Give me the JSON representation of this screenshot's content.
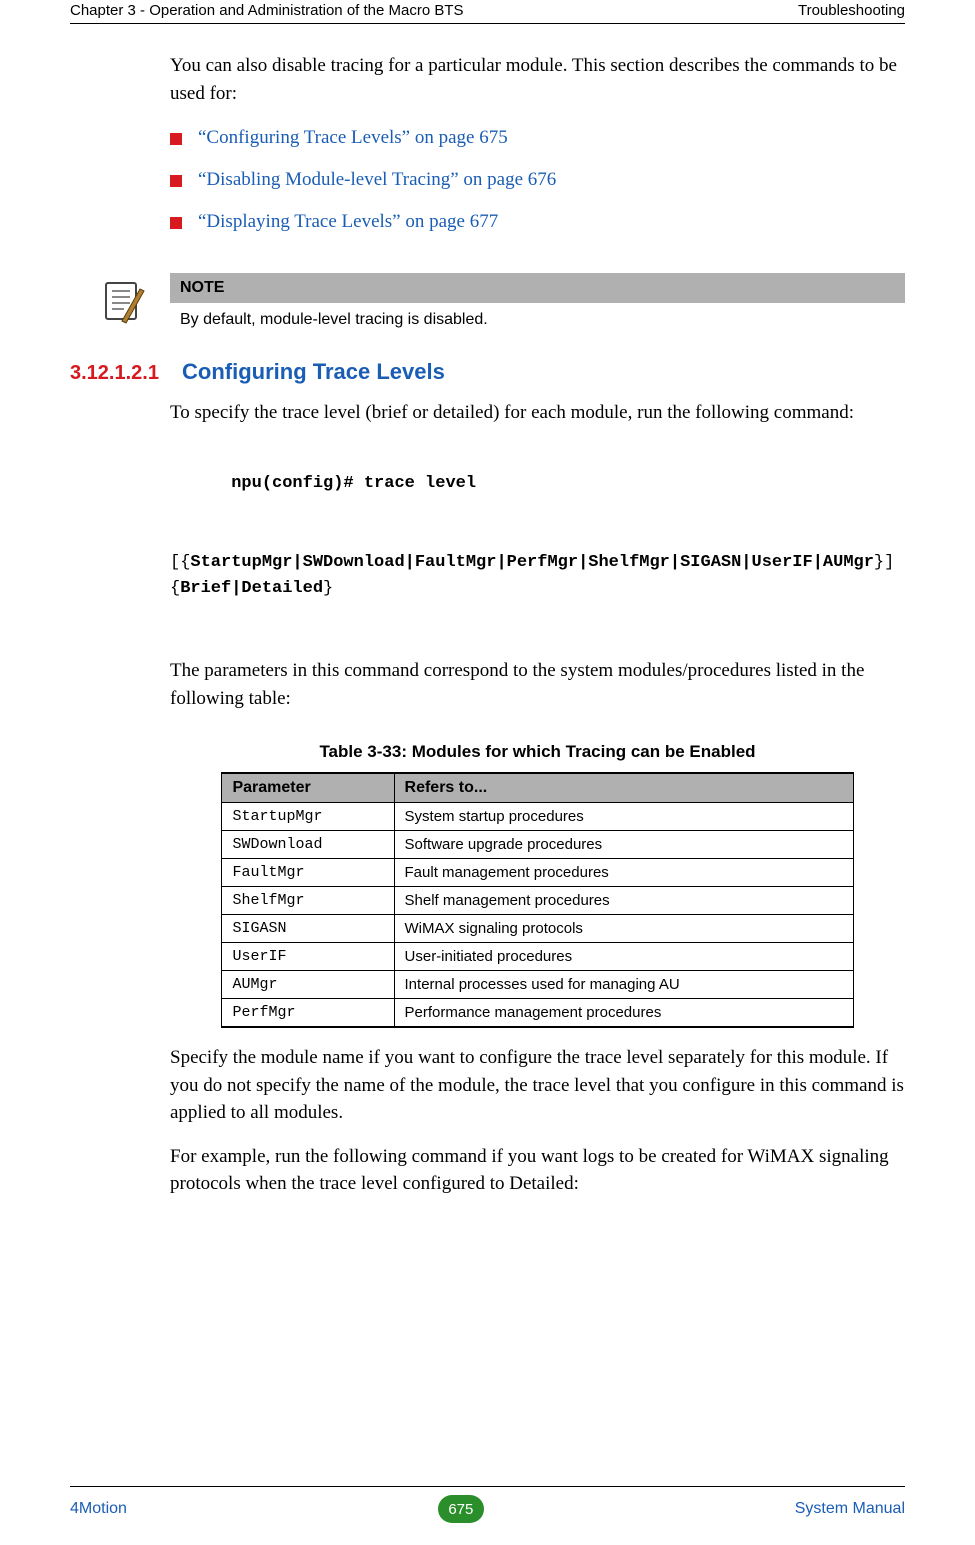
{
  "header": {
    "left": "Chapter 3 - Operation and Administration of the Macro BTS",
    "right": "Troubleshooting"
  },
  "intro_para": "You can also disable tracing for a particular module. This section describes the commands to be used for:",
  "bullets": [
    "“Configuring Trace Levels” on page 675",
    "“Disabling Module-level Tracing” on page 676",
    "“Displaying Trace Levels” on page 677"
  ],
  "note": {
    "title": "NOTE",
    "body": "By default, module-level tracing is disabled."
  },
  "section": {
    "number": "3.12.1.2.1",
    "title": "Configuring Trace Levels",
    "intro": "To specify the trace level (brief or detailed) for each module, run the following command:",
    "command_line1": "npu(config)# trace level",
    "command_line2_pre": "[{",
    "command_line2_mods": "StartupMgr|SWDownload|FaultMgr|PerfMgr|ShelfMgr|SIGASN|UserIF|AUMgr",
    "command_line2_mid": "}] {",
    "command_line2_opts": "Brief|Detailed",
    "command_line2_post": "}",
    "after_command": "The parameters in this command correspond to the system modules/procedures listed in the following table:"
  },
  "table": {
    "caption": "Table 3-33: Modules for which Tracing can be Enabled",
    "headers": [
      "Parameter",
      "Refers to..."
    ],
    "rows": [
      [
        "StartupMgr",
        "System startup procedures"
      ],
      [
        "SWDownload",
        "Software upgrade procedures"
      ],
      [
        "FaultMgr",
        "Fault management procedures"
      ],
      [
        "ShelfMgr",
        "Shelf management procedures"
      ],
      [
        "SIGASN",
        "WiMAX signaling protocols"
      ],
      [
        "UserIF",
        "User-initiated procedures"
      ],
      [
        "AUMgr",
        "Internal processes used for managing AU"
      ],
      [
        "PerfMgr",
        "Performance management procedures"
      ]
    ]
  },
  "post_table_para1": "Specify the module name if you want to configure the trace level separately for this module. If you do not specify the name of the module, the trace level that you configure in this command is applied to all modules.",
  "post_table_para2": "For example, run the following command if you want logs to be created for WiMAX signaling protocols when the trace level configured to Detailed:",
  "footer": {
    "left": "4Motion",
    "page": "675",
    "right": "System Manual"
  }
}
